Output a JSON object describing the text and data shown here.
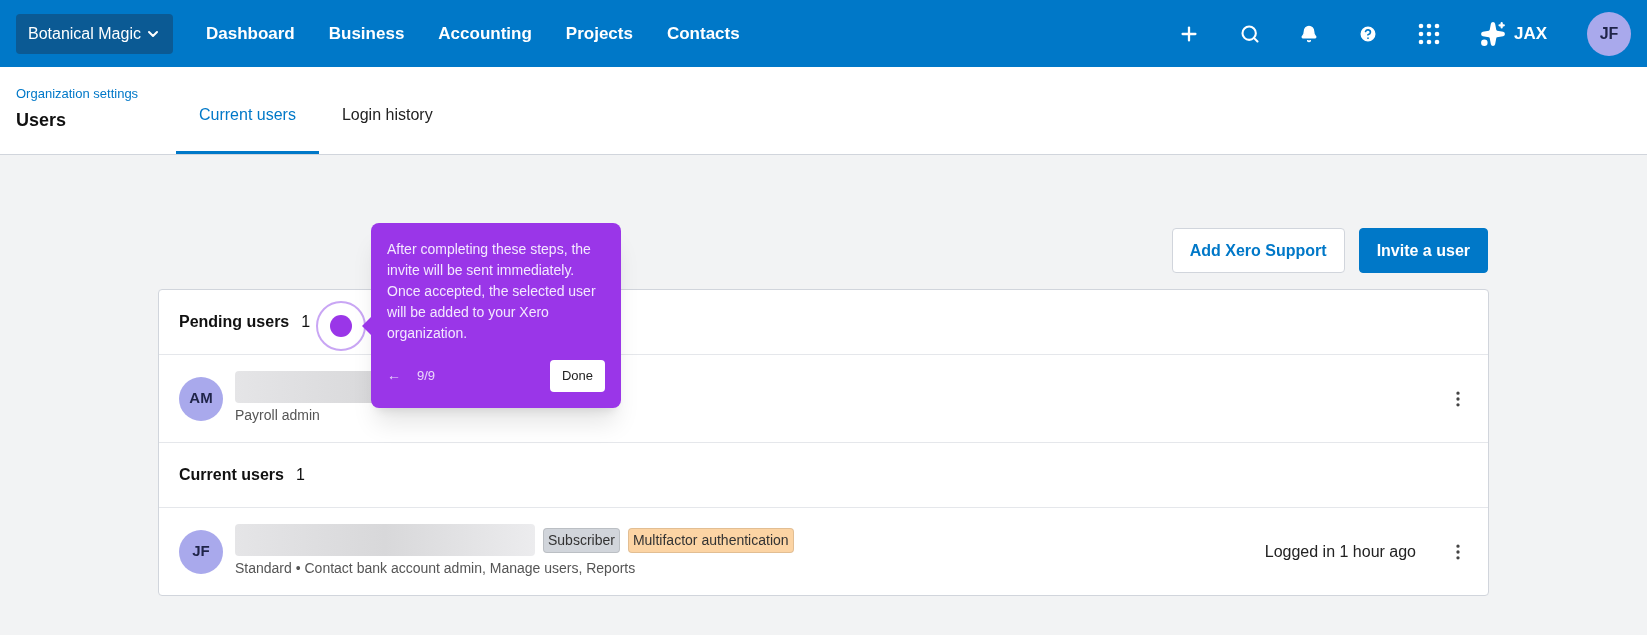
{
  "org_switcher": {
    "label": "Botanical Magic"
  },
  "nav": [
    {
      "label": "Dashboard"
    },
    {
      "label": "Business"
    },
    {
      "label": "Accounting"
    },
    {
      "label": "Projects"
    },
    {
      "label": "Contacts"
    }
  ],
  "assistant": {
    "label": "JAX"
  },
  "profile": {
    "initials": "JF"
  },
  "breadcrumb": "Organization settings",
  "page_title": "Users",
  "tabs": [
    {
      "label": "Current users",
      "selected": true
    },
    {
      "label": "Login history",
      "selected": false
    }
  ],
  "actions": [
    {
      "label": "Add Xero Support",
      "kind": "secondary"
    },
    {
      "label": "Invite a user",
      "kind": "primary"
    }
  ],
  "sections": [
    {
      "title": "Pending users",
      "count": "1",
      "users": [
        {
          "initials": "AM",
          "detail": "Payroll admin"
        }
      ]
    },
    {
      "title": "Current users",
      "count": "1",
      "users": [
        {
          "initials": "JF",
          "tags": [
            {
              "label": "Subscriber",
              "color": "#d1d5db"
            },
            {
              "label": "Multifactor authentication",
              "color": "#fcd4a4"
            }
          ],
          "detail": "Standard • Contact bank account admin, Manage users, Reports",
          "status": "Logged in 1 hour ago"
        }
      ]
    }
  ],
  "tooltip": {
    "text": "After completing these steps, the invite will be sent immediately. Once accepted, the selected user will be added to your Xero organization.",
    "back": "←",
    "step": "9/9",
    "done": "Done"
  }
}
